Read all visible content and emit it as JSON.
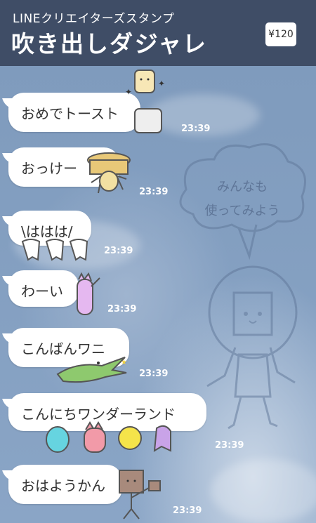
{
  "header": {
    "subtitle": "LINEクリエイターズスタンプ",
    "title": "吹き出しダジャレ",
    "price": "¥120"
  },
  "messages": [
    {
      "text": "おめでトースト",
      "time": "23:39",
      "sticker": "toast-icon"
    },
    {
      "text": "おっけー",
      "time": "23:39",
      "sticker": "tub-character-icon"
    },
    {
      "text": "\\ははは/",
      "time": "23:39",
      "sticker": "teeth-icon"
    },
    {
      "text": "わーい",
      "time": "23:39",
      "sticker": "cat-cheer-icon"
    },
    {
      "text": "こんばんワニ",
      "time": "23:39",
      "sticker": "crocodile-icon"
    },
    {
      "text": "こんにちワンダーランド",
      "time": "23:39",
      "sticker": "monsters-icon"
    },
    {
      "text": "おはようかん",
      "time": "23:39",
      "sticker": "yokan-character-icon"
    }
  ],
  "background_sample": {
    "line1": "みんなも",
    "line2": "使ってみよう"
  },
  "colors": {
    "header": "#3f4d66",
    "chat_bg": "#7f9bbd",
    "bubble": "#ffffff"
  }
}
